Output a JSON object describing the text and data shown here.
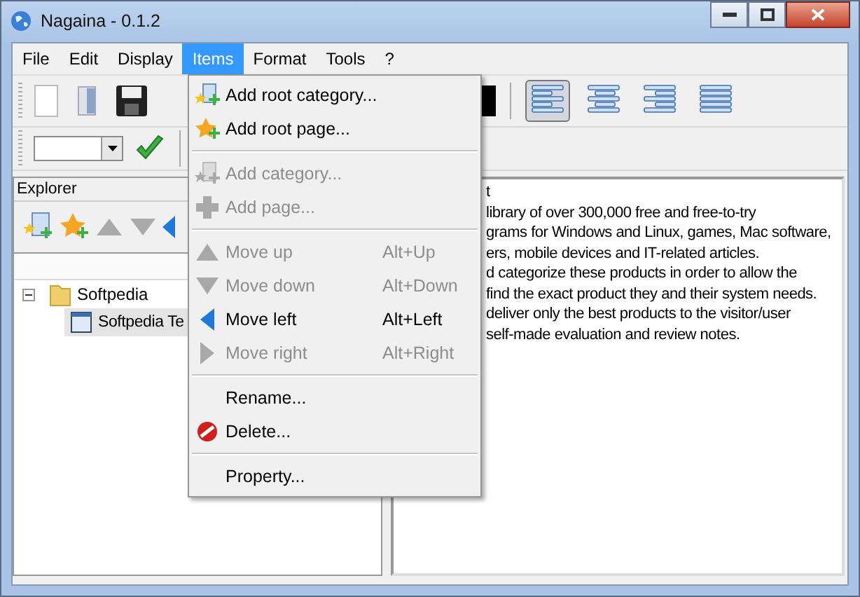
{
  "window": {
    "title": "Nagaina - 0.1.2"
  },
  "menu_bar": [
    {
      "label": "File",
      "selected": false
    },
    {
      "label": "Edit",
      "selected": false
    },
    {
      "label": "Display",
      "selected": false
    },
    {
      "label": "Items",
      "selected": true
    },
    {
      "label": "Format",
      "selected": false
    },
    {
      "label": "Tools",
      "selected": false
    },
    {
      "label": "?",
      "selected": false
    }
  ],
  "toolbar": {
    "align_buttons": [
      {
        "kind": "left",
        "selected": true
      },
      {
        "kind": "center",
        "selected": false
      },
      {
        "kind": "right",
        "selected": false
      },
      {
        "kind": "justify",
        "selected": false
      }
    ]
  },
  "explorer": {
    "title": "Explorer",
    "tree": [
      {
        "label": "Softpedia",
        "expanded": true,
        "children": [
          {
            "label": "Softpedia Te",
            "selected": true
          }
        ]
      }
    ]
  },
  "editor": {
    "lines": [
      "t",
      "library of over 300,000 free and free-to-try",
      "grams for Windows and Linux, games, Mac software,",
      "ers, mobile devices and IT-related articles.",
      "d categorize these products in order to allow the",
      "find the exact product they and their system needs.",
      "deliver only the best products to the visitor/user",
      "self-made evaluation and review notes."
    ]
  },
  "items_menu": [
    {
      "kind": "item",
      "label": "Add root category...",
      "disabled": false
    },
    {
      "kind": "item",
      "label": "Add root page...",
      "disabled": false
    },
    {
      "kind": "separator"
    },
    {
      "kind": "item",
      "label": "Add category...",
      "disabled": true
    },
    {
      "kind": "item",
      "label": "Add page...",
      "disabled": true
    },
    {
      "kind": "separator"
    },
    {
      "kind": "item",
      "label": "Move up",
      "shortcut": "Alt+Up",
      "disabled": true
    },
    {
      "kind": "item",
      "label": "Move down",
      "shortcut": "Alt+Down",
      "disabled": true
    },
    {
      "kind": "item",
      "label": "Move left",
      "shortcut": "Alt+Left",
      "disabled": false
    },
    {
      "kind": "item",
      "label": "Move right",
      "shortcut": "Alt+Right",
      "disabled": true
    },
    {
      "kind": "separator"
    },
    {
      "kind": "item",
      "label": "Rename...",
      "disabled": false
    },
    {
      "kind": "item",
      "label": "Delete...",
      "disabled": false
    },
    {
      "kind": "separator"
    },
    {
      "kind": "item",
      "label": "Property...",
      "disabled": false
    }
  ]
}
